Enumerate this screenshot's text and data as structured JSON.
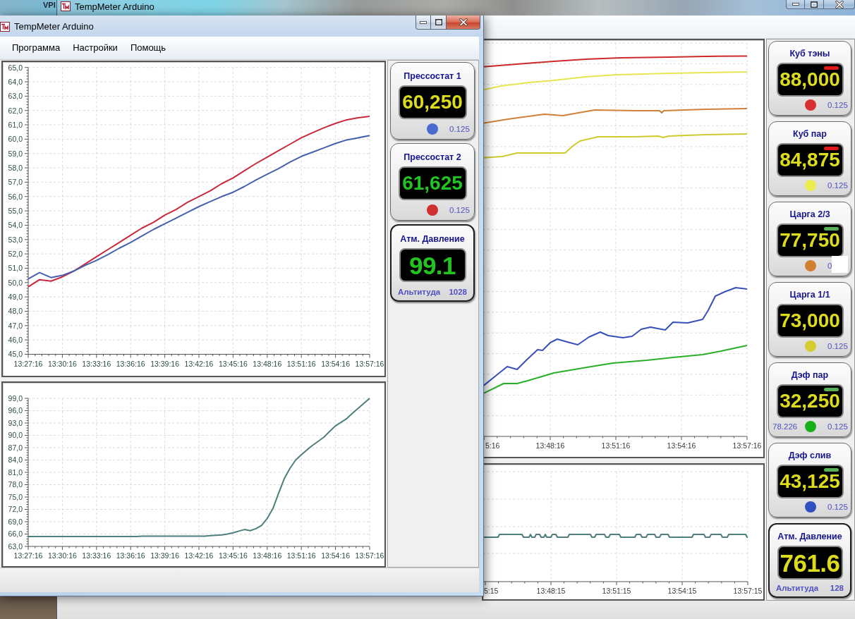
{
  "desktop": {
    "cut_title": "VPI"
  },
  "back_window": {
    "title": "TempMeter Arduino",
    "main_chart": {
      "x_labels": [
        "5:16",
        "13:48:16",
        "13:51:16",
        "13:54:16",
        "13:57:16"
      ]
    },
    "lower_chart": {
      "x_labels": [
        "5:15",
        "13:48:15",
        "13:51:15",
        "13:54:15",
        "13:57:15"
      ]
    },
    "gauges": [
      {
        "kind": "sensor",
        "label": "Куб тэны",
        "display": {
          "value": "88,000",
          "color": "#dcdc1c"
        },
        "indicator": {
          "color": "#e01818"
        },
        "color": "#d83030",
        "reading": "0.125"
      },
      {
        "kind": "sensor",
        "label": "Куб пар",
        "display": {
          "value": "84,875",
          "color": "#dcdc1c"
        },
        "indicator": {
          "color": "#e01818"
        },
        "color": "#ecec50",
        "reading": "0.125"
      },
      {
        "kind": "sensor",
        "label": "Царга 2/3",
        "display": {
          "value": "77,750",
          "color": "#dcdc1c"
        },
        "indicator": {
          "color": "#58b058"
        },
        "color": "#d08030",
        "reading": "0",
        "obscured": true
      },
      {
        "kind": "sensor",
        "label": "Царга 1/1",
        "display": {
          "value": "73,000",
          "color": "#dcdc1c"
        },
        "color": "#d4cc30",
        "reading": "0.125"
      },
      {
        "kind": "sensor",
        "label": "Дэф пар",
        "display": {
          "value": "32,250",
          "color": "#dcdc1c"
        },
        "indicator": {
          "color": "#58b058"
        },
        "color": "#18b018",
        "extra": "78.226",
        "reading": "0.125"
      },
      {
        "kind": "sensor",
        "label": "Дэф слив",
        "display": {
          "value": "43,125",
          "color": "#dcdc1c"
        },
        "indicator": {
          "color": "#58b058"
        },
        "color": "#3050c0",
        "reading": "0.125"
      },
      {
        "kind": "pressure",
        "label": "Атм. Давление",
        "display": {
          "value": "761.6",
          "color": "#dcdc1c"
        },
        "caption": "Альтитуда",
        "reading": "128"
      }
    ]
  },
  "front_window": {
    "title": "TempMeter Arduino",
    "menu": [
      "Программа",
      "Настройки",
      "Помощь"
    ],
    "charts": [
      {
        "chart_data": {
          "type": "line",
          "grid": true,
          "ylim": [
            45,
            65
          ],
          "categories": [
            "13:27:16",
            null,
            null,
            "13:30:16",
            null,
            null,
            "13:33:16",
            null,
            null,
            "13:36:16",
            null,
            null,
            "13:39:16",
            null,
            null,
            "13:42:16",
            null,
            null,
            "13:45:16",
            null,
            null,
            "13:48:16",
            null,
            null,
            "13:51:16",
            null,
            null,
            "13:54:16",
            null,
            null,
            "13:57:16"
          ],
          "yticks": [
            {
              "value": 45,
              "label": "45,0"
            },
            {
              "value": 46,
              "label": "46,0"
            },
            {
              "value": 47,
              "label": "47,0"
            },
            {
              "value": 48,
              "label": "48,0"
            },
            {
              "value": 49,
              "label": "49,0"
            },
            {
              "value": 50,
              "label": "50,0"
            },
            {
              "value": 51,
              "label": "51,0"
            },
            {
              "value": 52,
              "label": "52,0"
            },
            {
              "value": 53,
              "label": "53,0"
            },
            {
              "value": 54,
              "label": "54,0"
            },
            {
              "value": 55,
              "label": "55,0"
            },
            {
              "value": 56,
              "label": "56,0"
            },
            {
              "value": 57,
              "label": "57,0"
            },
            {
              "value": 58,
              "label": "58,0"
            },
            {
              "value": 59,
              "label": "59,0"
            },
            {
              "value": 60,
              "label": "60,0"
            },
            {
              "value": 61,
              "label": "61,0"
            },
            {
              "value": 62,
              "label": "62,0"
            },
            {
              "value": 63,
              "label": "63,0"
            },
            {
              "value": 64,
              "label": "64,0"
            },
            {
              "value": 65,
              "label": "65,0"
            }
          ],
          "series": [
            {
              "color": "#c8283c",
              "values": [
                49.7,
                50.2,
                50.1,
                50.4,
                50.8,
                51.3,
                51.8,
                52.3,
                52.8,
                53.3,
                53.8,
                54.2,
                54.7,
                55.1,
                55.6,
                56.0,
                56.4,
                56.9,
                57.3,
                57.8,
                58.3,
                58.75,
                59.2,
                59.65,
                60.1,
                60.45,
                60.8,
                61.1,
                61.35,
                61.5,
                61.6
              ]
            },
            {
              "color": "#4660b0",
              "values": [
                50.25,
                50.7,
                50.35,
                50.5,
                50.8,
                51.2,
                51.55,
                51.95,
                52.4,
                52.8,
                53.25,
                53.7,
                54.1,
                54.5,
                54.9,
                55.3,
                55.65,
                56.0,
                56.3,
                56.7,
                57.15,
                57.55,
                57.95,
                58.4,
                58.8,
                59.1,
                59.4,
                59.7,
                59.95,
                60.1,
                60.25
              ]
            }
          ]
        }
      },
      {
        "chart_data": {
          "type": "line",
          "grid": true,
          "ylim": [
            63,
            99
          ],
          "categories": [
            "13:27:16",
            null,
            null,
            null,
            null,
            null,
            "13:30:16",
            null,
            null,
            null,
            null,
            null,
            "13:33:16",
            null,
            null,
            null,
            null,
            null,
            "13:36:16",
            null,
            null,
            null,
            null,
            null,
            "13:39:16",
            null,
            null,
            null,
            null,
            null,
            "13:42:16",
            null,
            null,
            null,
            null,
            null,
            "13:45:16",
            null,
            null,
            null,
            null,
            null,
            "13:48:16",
            null,
            null,
            null,
            null,
            null,
            "13:51:16",
            null,
            null,
            null,
            null,
            null,
            "13:54:16",
            null,
            null,
            null,
            null,
            null,
            "13:57:16"
          ],
          "yticks": [
            {
              "value": 63,
              "label": "63,0"
            },
            {
              "value": 66,
              "label": "66,0"
            },
            {
              "value": 69,
              "label": "69,0"
            },
            {
              "value": 72,
              "label": "72,0"
            },
            {
              "value": 75,
              "label": "75,0"
            },
            {
              "value": 78,
              "label": "78,0"
            },
            {
              "value": 81,
              "label": "81,0"
            },
            {
              "value": 84,
              "label": "84,0"
            },
            {
              "value": 87,
              "label": "87,0"
            },
            {
              "value": 90,
              "label": "90,0"
            },
            {
              "value": 93,
              "label": "93,0"
            },
            {
              "value": 96,
              "label": "96,0"
            },
            {
              "value": 99,
              "label": "99,0"
            }
          ],
          "series": [
            {
              "color": "#4d7f7c",
              "values": [
                65.4,
                65.4,
                65.4,
                65.4,
                65.4,
                65.4,
                65.4,
                65.4,
                65.4,
                65.4,
                65.4,
                65.4,
                65.4,
                65.4,
                65.4,
                65.4,
                65.4,
                65.4,
                65.4,
                65.4,
                65.5,
                65.5,
                65.5,
                65.5,
                65.5,
                65.5,
                65.5,
                65.5,
                65.5,
                65.5,
                65.5,
                65.5,
                65.6,
                65.7,
                65.8,
                66.0,
                66.3,
                66.7,
                67.1,
                66.8,
                67.3,
                68.1,
                69.8,
                72.2,
                75.9,
                79.5,
                82.0,
                84.0,
                85.3,
                86.5,
                87.6,
                88.6,
                89.6,
                91.0,
                92.3,
                93.2,
                94.1,
                95.4,
                96.6,
                97.8,
                99.0
              ]
            }
          ]
        }
      }
    ],
    "gauges": [
      {
        "kind": "sensor",
        "label": "Прессостат 1",
        "display": {
          "value": "60,250",
          "color": "#dcdc1c"
        },
        "color": "#4a6ad0",
        "reading": "0.125"
      },
      {
        "kind": "sensor",
        "label": "Прессостат 2",
        "display": {
          "value": "61,625",
          "color": "#22c422"
        },
        "color": "#d03030",
        "reading": "0.125"
      },
      {
        "kind": "pressure",
        "label": "Атм. Давление",
        "display": {
          "value": "99.1",
          "color": "#22c422"
        },
        "caption": "Альтитуда",
        "reading": "1028"
      }
    ]
  }
}
